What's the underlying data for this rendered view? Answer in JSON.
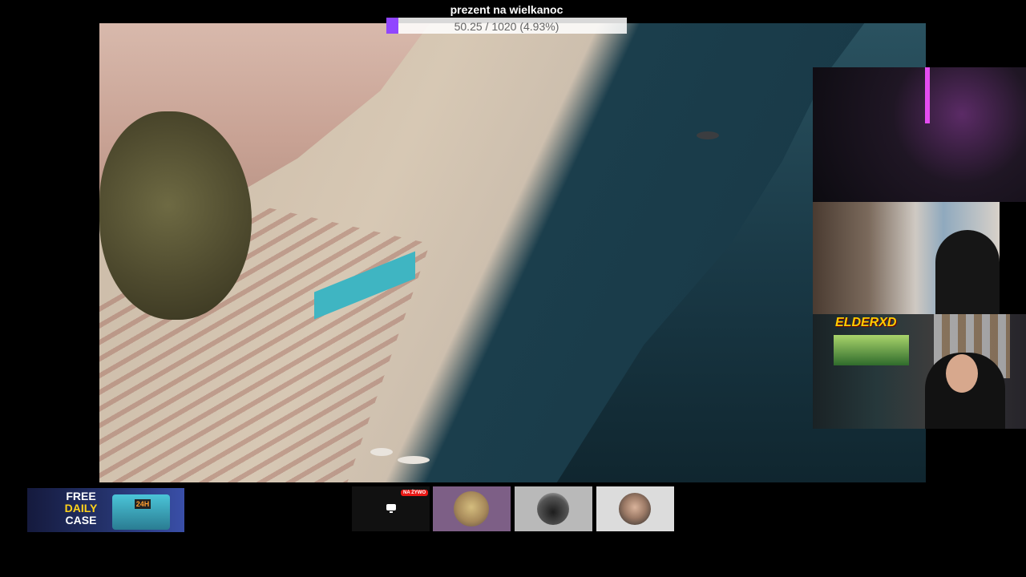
{
  "goal": {
    "title": "prezent na wielkanoc",
    "progress_text": "50.25 / 1020 (4.93%)",
    "progress_fraction": 0.0493,
    "fill_color": "#9146ff"
  },
  "webcams": {
    "cam3_label": "ELDERXD"
  },
  "promo": {
    "line1": "FREE",
    "line2": "DAILY",
    "line3": "CASE",
    "timer": "24H"
  },
  "tiles": {
    "live_badge": "NA ŻYWO",
    "live_icon": "monitor-icon"
  }
}
